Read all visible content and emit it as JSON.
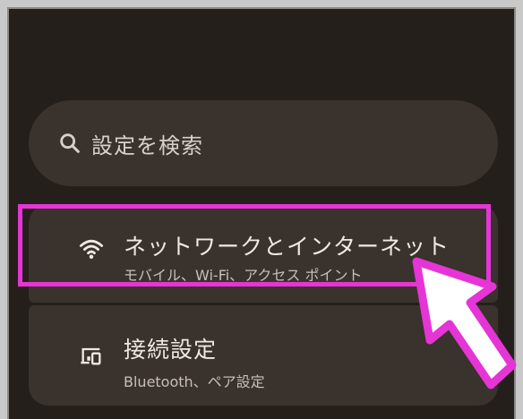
{
  "search": {
    "placeholder": "設定を検索",
    "icon": "search-icon"
  },
  "settings_items": [
    {
      "title": "ネットワークとインターネット",
      "subtitle": "モバイル、Wi-Fi、アクセス ポイント",
      "icon": "wifi-icon"
    },
    {
      "title": "接続設定",
      "subtitle": "Bluetooth、ペア設定",
      "icon": "devices-icon"
    }
  ],
  "colors": {
    "background": "#241f1b",
    "card": "#3a322c",
    "highlight": "#e535d6",
    "arrow_fill": "#ffffff"
  }
}
